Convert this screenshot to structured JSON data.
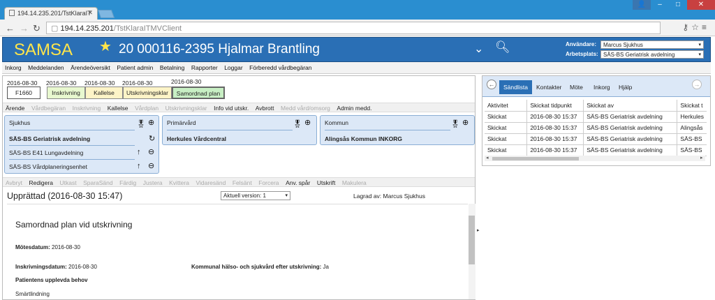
{
  "browser": {
    "tab_title": "194.14.235.201/TstKlaraIT",
    "url_host": "194.14.235.201",
    "url_path": "/TstKlaraITMVClient",
    "icons": {
      "back": "back-arrow-icon",
      "forward": "forward-arrow-icon",
      "reload": "reload-icon",
      "key": "key-icon",
      "star": "bookmark-star-icon",
      "menu": "menu-icon"
    }
  },
  "app": {
    "name": "SAMSA",
    "patient": "20 000116-2395 Hjalmar Brantling",
    "user_label": "Användare:",
    "user_value": "Marcus Sjukhus",
    "workplace_label": "Arbetsplats:",
    "workplace_value": "SÄS-BS Geriatrisk avdelning",
    "colors": {
      "header": "#2a6fb5",
      "accent": "#ffe54a",
      "card": "#dce8f7"
    }
  },
  "menu": [
    "Inkorg",
    "Meddelanden",
    "Ärendeöversikt",
    "Patient admin",
    "Betalning",
    "Rapporter",
    "Loggar",
    "Förberedd vårdbegäran"
  ],
  "process": {
    "dates": [
      "2016-08-30",
      "2016-08-30",
      "2016-08-30",
      "2016-08-30",
      "2016-08-30"
    ],
    "code": "F1660",
    "steps": [
      "Inskrivning",
      "Kallelse",
      "Utskrivningsklar",
      "Samordnad plan"
    ]
  },
  "toolbar1": [
    {
      "label": "Ärende",
      "enabled": true
    },
    {
      "label": "Vårdbegäran",
      "enabled": false
    },
    {
      "label": "Inskrivning",
      "enabled": false
    },
    {
      "label": "Kallelse",
      "enabled": true
    },
    {
      "label": "Vårdplan",
      "enabled": false
    },
    {
      "label": "Utskrivningsklar",
      "enabled": false
    },
    {
      "label": "Info vid utskr.",
      "enabled": true
    },
    {
      "label": "Avbrott",
      "enabled": true
    },
    {
      "label": "Medd vård/omsorg",
      "enabled": false
    },
    {
      "label": "Admin medd.",
      "enabled": true
    }
  ],
  "cards": {
    "sjukhus": {
      "title": "Sjukhus",
      "items": [
        "SÄS-BS Geriatrisk avdelning",
        "SÄS-BS E41 Lungavdelning",
        "SÄS-BS Vårdplaneringsenhet"
      ]
    },
    "primarvard": {
      "title": "Primärvård",
      "items": [
        "Herkules Vårdcentral"
      ]
    },
    "kommun": {
      "title": "Kommun",
      "items": [
        "Alingsås Kommun INKORG"
      ]
    }
  },
  "toolbar2": [
    {
      "label": "Avbryt",
      "enabled": false
    },
    {
      "label": "Redigera",
      "enabled": true
    },
    {
      "label": "Utkast",
      "enabled": false
    },
    {
      "label": "SparaSänd",
      "enabled": false
    },
    {
      "label": "Färdig",
      "enabled": false
    },
    {
      "label": "Justera",
      "enabled": false
    },
    {
      "label": "Kvittera",
      "enabled": false
    },
    {
      "label": "Vidaresänd",
      "enabled": false
    },
    {
      "label": "Felsänt",
      "enabled": false
    },
    {
      "label": "Forcera",
      "enabled": false
    },
    {
      "label": "Anv. spår",
      "enabled": true
    },
    {
      "label": "Utskrift",
      "enabled": true
    },
    {
      "label": "Makulera",
      "enabled": false
    }
  ],
  "document": {
    "status_title": "Upprättad (2016-08-30 15:47)",
    "version": "Aktuell version: 1",
    "saved_by": "Lagrad av: Marcus Sjukhus",
    "heading": "Samordnad plan vid utskrivning",
    "meeting_label": "Mötesdatum:",
    "meeting_value": "2016-08-30",
    "intake_label": "Inskrivningsdatum:",
    "intake_value": "2016-08-30",
    "municipal_label": "Kommunal hälso- och sjukvård efter utskrivning:",
    "municipal_value": "Ja",
    "needs_label": "Patientens upplevda behov",
    "needs_value": "Smärtlindning"
  },
  "right": {
    "tabs": [
      "Sändlista",
      "Kontakter",
      "Möte",
      "Inkorg",
      "Hjälp"
    ],
    "columns": [
      "Aktivitet",
      "Skickat tidpunkt",
      "Skickat av",
      "Skickat t"
    ],
    "rows": [
      [
        "Skickat",
        "2016-08-30 15:37",
        "SÄS-BS Geriatrisk avdelning",
        "Herkules"
      ],
      [
        "Skickat",
        "2016-08-30 15:37",
        "SÄS-BS Geriatrisk avdelning",
        "Alingsås"
      ],
      [
        "Skickat",
        "2016-08-30 15:37",
        "SÄS-BS Geriatrisk avdelning",
        "SÄS-BS"
      ],
      [
        "Skickat",
        "2016-08-30 15:37",
        "SÄS-BS Geriatrisk avdelning",
        "SÄS-BS"
      ]
    ]
  }
}
